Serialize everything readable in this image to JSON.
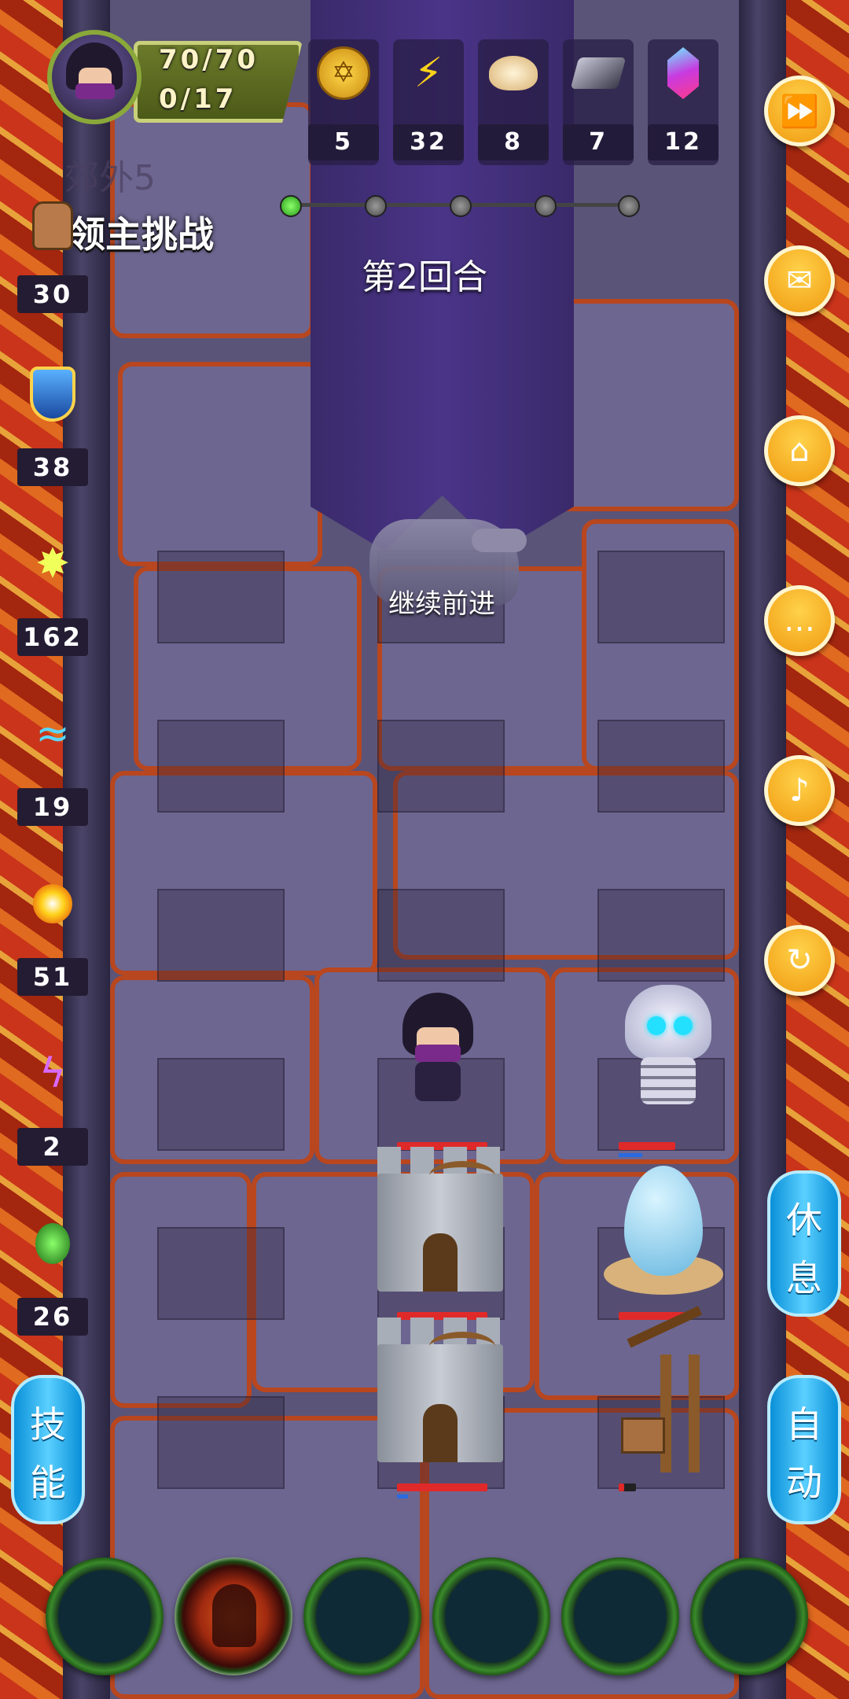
{
  "player": {
    "hp": "70/70",
    "exp": "0/17"
  },
  "resources": [
    {
      "icon": "coin-icon",
      "value": "5"
    },
    {
      "icon": "lightning-icon",
      "value": "32"
    },
    {
      "icon": "bun-icon",
      "value": "8"
    },
    {
      "icon": "iron-ore-icon",
      "value": "7"
    },
    {
      "icon": "crystal-icon",
      "value": "12"
    }
  ],
  "stage": {
    "label": "郊外5",
    "challenge": "领主挑战",
    "round": "第2回合",
    "progress_current": 1,
    "progress_total": 5
  },
  "hint": "继续前进",
  "stats": [
    {
      "icon": "fist-icon",
      "value": "30"
    },
    {
      "icon": "shield-icon",
      "value": "38"
    },
    {
      "icon": "sword-burst-icon",
      "value": "162"
    },
    {
      "icon": "water-wave-icon",
      "value": "19"
    },
    {
      "icon": "fireball-icon",
      "value": "51"
    },
    {
      "icon": "lightning-magic-icon",
      "value": "2"
    },
    {
      "icon": "poison-icon",
      "value": "26"
    }
  ],
  "buttons": {
    "skill": "技能",
    "rest": "休息",
    "auto": "自动"
  },
  "menu_icons": [
    "fast-forward-icon",
    "mail-icon",
    "home-icon",
    "chat-icon",
    "sound-icon",
    "return-icon"
  ],
  "units": {
    "hero_hp": 1.0,
    "skeleton_hp": 1.0,
    "tower1_hp": 1.0,
    "tower2_hp": 1.0,
    "egg_hp": 1.0,
    "crane_hp": 0.3
  },
  "skill_slots": 6,
  "colors": {
    "accent": "#f5a623",
    "side_button": "#1aa3e8",
    "hp": "#e02a2a"
  }
}
